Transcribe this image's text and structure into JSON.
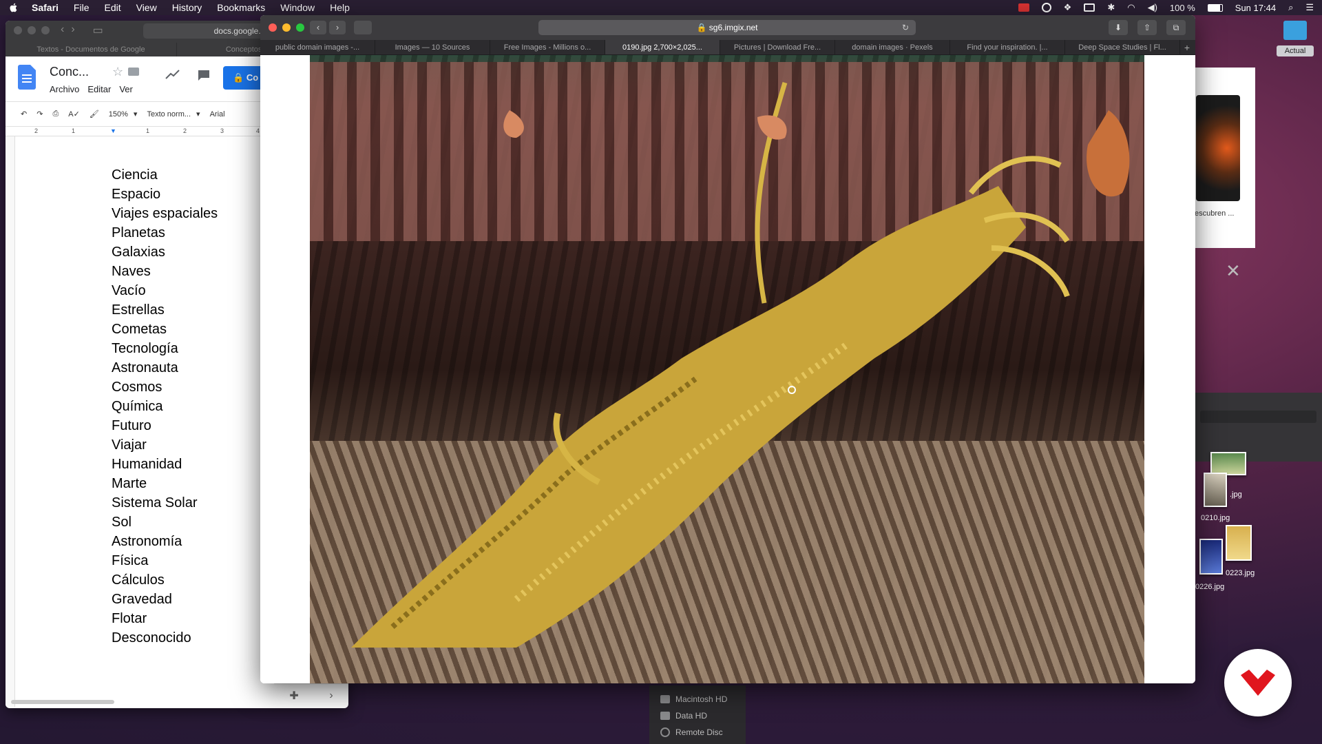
{
  "menubar": {
    "app": "Safari",
    "items": [
      "File",
      "Edit",
      "View",
      "History",
      "Bookmarks",
      "Window",
      "Help"
    ],
    "battery": "100 %",
    "clock": "Sun 17:44"
  },
  "docs": {
    "url": "docs.google.com",
    "tabs": [
      "Textos - Documentos de Google",
      "Conceptos - Docum..."
    ],
    "title": "Conc...",
    "menu": [
      "Archivo",
      "Editar",
      "Ver"
    ],
    "share_label": "Co",
    "zoom": "150%",
    "style": "Texto norm...",
    "font": "Arial",
    "ruler": [
      "2",
      "1",
      "1",
      "2",
      "3",
      "4"
    ],
    "list": [
      "Ciencia",
      "Espacio",
      "Viajes espaciales",
      "Planetas",
      "Galaxias",
      "Naves",
      "Vacío",
      "Estrellas",
      "Cometas",
      "Tecnología",
      "Astronauta",
      "Cosmos",
      "Química",
      "Futuro",
      "Viajar",
      "Humanidad",
      "Marte",
      "Sistema Solar",
      "Sol",
      "Astronomía",
      "Física",
      "Cálculos",
      "Gravedad",
      "Flotar",
      "Desconocido"
    ]
  },
  "safari": {
    "url": "sg6.imgix.net",
    "tabs": [
      {
        "label": "public domain images -...",
        "active": false
      },
      {
        "label": "Images — 10 Sources",
        "active": false
      },
      {
        "label": "Free Images - Millions o...",
        "active": false
      },
      {
        "label": "0190.jpg 2,700×2,025...",
        "active": true
      },
      {
        "label": "Pictures | Download Fre...",
        "active": false
      },
      {
        "label": "domain images · Pexels",
        "active": false
      },
      {
        "label": "Find your inspiration. |...",
        "active": false
      },
      {
        "label": "Deep Space Studies | Fl...",
        "active": false
      }
    ]
  },
  "background_window": {
    "caption": "escubren ..."
  },
  "finder": {
    "items": [
      "Macintosh HD",
      "Data HD",
      "Remote Disc"
    ]
  },
  "desktop": {
    "folder_label": "Actual",
    "files": [
      ".jpg",
      "0210.jpg",
      "0223.jpg",
      "0226.jpg"
    ]
  },
  "colors": {
    "docs_blue": "#4285f4",
    "share_blue": "#1a73e8",
    "badge_red": "#e0161e"
  }
}
